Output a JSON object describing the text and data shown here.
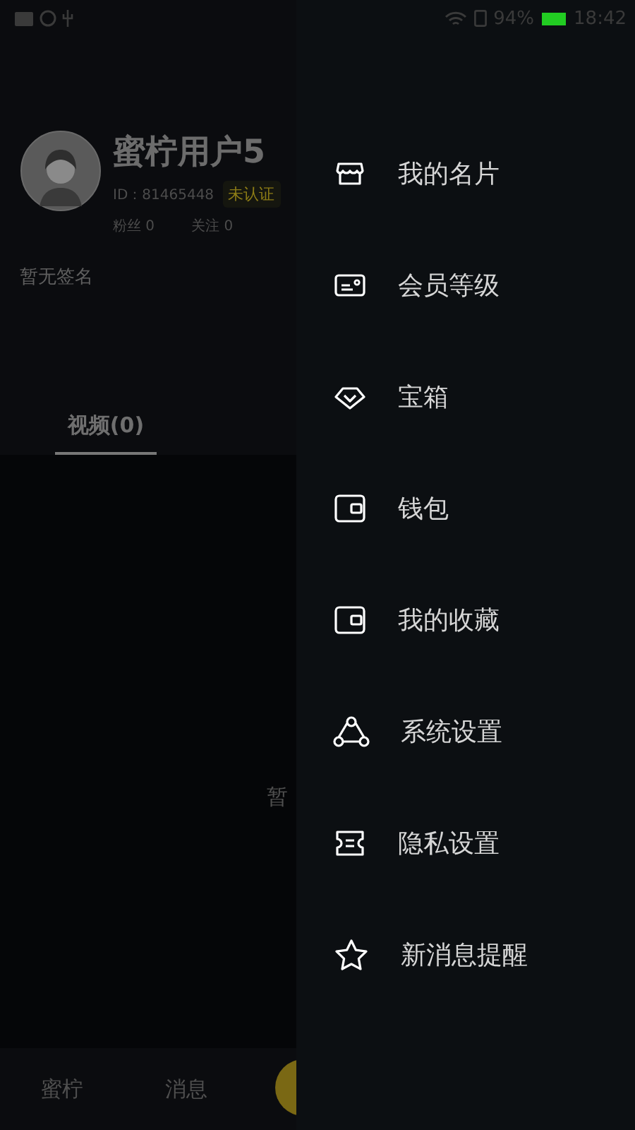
{
  "status_bar": {
    "battery": "94%",
    "time": "18:42"
  },
  "profile": {
    "name": "蜜柠用户5",
    "id": "ID：81465448",
    "badge": "未认证",
    "stats": [
      {
        "label": "粉丝",
        "value": "0"
      },
      {
        "label": "关注",
        "value": "0"
      }
    ],
    "signature": "暂无签名"
  },
  "tabs": [
    {
      "label": "视频(0)",
      "selected": true
    }
  ],
  "empty_state": {
    "text": "暂"
  },
  "bottom_nav": [
    {
      "label": "蜜柠"
    },
    {
      "label": "消息"
    }
  ],
  "drawer": {
    "items": [
      {
        "label": "我的名片"
      },
      {
        "label": "会员等级"
      },
      {
        "label": "宝箱"
      },
      {
        "label": "钱包"
      },
      {
        "label": "我的收藏"
      },
      {
        "label": "系统设置"
      },
      {
        "label": "隐私设置"
      },
      {
        "label": "新消息提醒"
      }
    ]
  }
}
